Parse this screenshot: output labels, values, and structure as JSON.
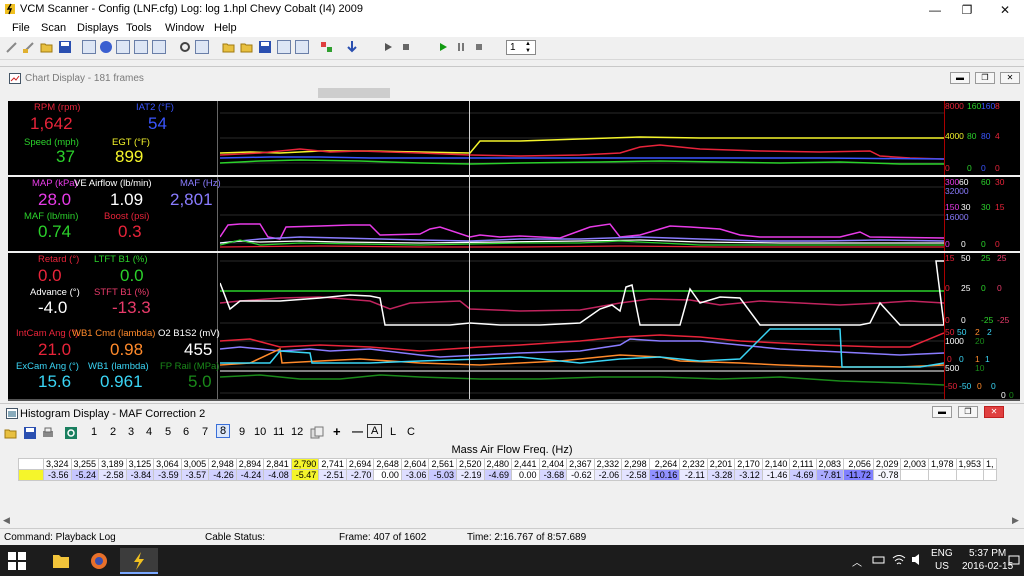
{
  "window": {
    "title": "VCM Scanner - Config (LNF.cfg)   Log: log 1.hpl   Chevy Cobalt (I4) 2009",
    "controls": {
      "minimize": "—",
      "maximize": "❐",
      "close": "✕"
    }
  },
  "menu": [
    "File",
    "Scan",
    "Displays",
    "Tools",
    "Window",
    "Help"
  ],
  "toolbar": {
    "spin_value": "1"
  },
  "chart_window": {
    "title": "Chart Display  -  181 frames",
    "panels": [
      {
        "params": [
          {
            "label": "RPM (rpm)",
            "value": "1,642",
            "color": "#e8243a"
          },
          {
            "label": "IAT2 (°F)",
            "value": "54",
            "color": "#3a55ff"
          },
          {
            "label": "Speed (mph)",
            "value": "37",
            "color": "#2bd12b"
          },
          {
            "label": "EGT (°F)",
            "value": "899",
            "color": "#f5f52b"
          }
        ],
        "scales": [
          {
            "text": "8000",
            "color": "#e8243a"
          },
          {
            "text": "160",
            "color": "#2bd12b"
          },
          {
            "text": "160",
            "color": "#3a55ff"
          },
          {
            "text": "8",
            "color": "#e8243a"
          },
          {
            "text": "4000",
            "color": "#f5f52b"
          },
          {
            "text": "80",
            "color": "#2bd12b"
          },
          {
            "text": "80",
            "color": "#3a55ff"
          },
          {
            "text": "4",
            "color": "#e8243a"
          },
          {
            "text": "0",
            "color": "#e8243a"
          },
          {
            "text": "0",
            "color": "#2bd12b"
          },
          {
            "text": "0",
            "color": "#3a55ff"
          },
          {
            "text": "0",
            "color": "#e8243a"
          }
        ]
      },
      {
        "params": [
          {
            "label": "MAP (kPa)",
            "value": "28.0",
            "color": "#e83be8"
          },
          {
            "label": "VE Airflow (lb/min)",
            "value": "1.09",
            "color": "#ffffff"
          },
          {
            "label": "MAF (Hz)",
            "value": "2,801",
            "color": "#8a7cff"
          },
          {
            "label": "MAF (lb/min)",
            "value": "0.74",
            "color": "#2bd12b"
          },
          {
            "label": "Boost (psi)",
            "value": "0.3",
            "color": "#e8243a"
          }
        ],
        "scales": [
          {
            "text": "300",
            "color": "#e83be8"
          },
          {
            "text": "60",
            "color": "#ffffff"
          },
          {
            "text": "60",
            "color": "#2bd12b"
          },
          {
            "text": "30",
            "color": "#e8243a"
          },
          {
            "text": "32000",
            "color": "#8a7cff"
          },
          {
            "text": "150",
            "color": "#e83be8"
          },
          {
            "text": "30",
            "color": "#ffffff"
          },
          {
            "text": "30",
            "color": "#2bd12b"
          },
          {
            "text": "15",
            "color": "#e8243a"
          },
          {
            "text": "16000",
            "color": "#8a7cff"
          },
          {
            "text": "0",
            "color": "#e83be8"
          },
          {
            "text": "0",
            "color": "#ffffff"
          },
          {
            "text": "0",
            "color": "#2bd12b"
          },
          {
            "text": "0",
            "color": "#e8243a"
          }
        ]
      },
      {
        "params": [
          {
            "label": "Retard (°)",
            "value": "0.0",
            "color": "#e8243a"
          },
          {
            "label": "LTFT B1 (%)",
            "value": "0.0",
            "color": "#2bd12b"
          },
          {
            "label": "Advance (°)",
            "value": "-4.0",
            "color": "#ffffff"
          },
          {
            "label": "STFT B1 (%)",
            "value": "-13.3",
            "color": "#e83b6a"
          }
        ],
        "scales": [
          {
            "text": "15",
            "color": "#e8243a"
          },
          {
            "text": "50",
            "color": "#ffffff"
          },
          {
            "text": "25",
            "color": "#2bd12b"
          },
          {
            "text": "25",
            "color": "#e83b6a"
          },
          {
            "text": "0",
            "color": "#e8243a"
          },
          {
            "text": "25",
            "color": "#ffffff"
          },
          {
            "text": "0",
            "color": "#2bd12b"
          },
          {
            "text": "0",
            "color": "#e83b6a"
          },
          {
            "text": "0",
            "color": "#e8243a"
          },
          {
            "text": "0",
            "color": "#ffffff"
          },
          {
            "text": "-25",
            "color": "#2bd12b"
          },
          {
            "text": "-25",
            "color": "#e83b6a"
          }
        ]
      },
      {
        "params": [
          {
            "label": "IntCam Ang (°)",
            "value": "21.0",
            "color": "#e8243a"
          },
          {
            "label": "WB1 Cmd (lambda)",
            "value": "0.98",
            "color": "#ff8a2b"
          },
          {
            "label": "O2 B1S2 (mV)",
            "value": "455",
            "color": "#ffffff"
          },
          {
            "label": "ExCam Ang (°)",
            "value": "15.6",
            "color": "#3ad5f5"
          },
          {
            "label": "WB1 (lambda)",
            "value": "0.961",
            "color": "#3ad5f5"
          },
          {
            "label": "FP Rail (MPa)",
            "value": "5.0",
            "color": "#1a8a1a"
          }
        ],
        "scales": [
          {
            "text": "50",
            "color": "#e8243a"
          },
          {
            "text": "50",
            "color": "#3ad5f5"
          },
          {
            "text": "2",
            "color": "#ff8a2b"
          },
          {
            "text": "2",
            "color": "#3ad5f5"
          },
          {
            "text": "1000",
            "color": "#ffffff"
          },
          {
            "text": "20",
            "color": "#1a8a1a"
          },
          {
            "text": "0",
            "color": "#e8243a"
          },
          {
            "text": "0",
            "color": "#3ad5f5"
          },
          {
            "text": "1",
            "color": "#ff8a2b"
          },
          {
            "text": "1",
            "color": "#3ad5f5"
          },
          {
            "text": "500",
            "color": "#ffffff"
          },
          {
            "text": "10",
            "color": "#1a8a1a"
          },
          {
            "text": "-50",
            "color": "#e8243a"
          },
          {
            "text": "-50",
            "color": "#3ad5f5"
          },
          {
            "text": "0",
            "color": "#ff8a2b"
          },
          {
            "text": "0",
            "color": "#3ad5f5"
          },
          {
            "text": "0",
            "color": "#ffffff"
          },
          {
            "text": "0",
            "color": "#1a8a1a"
          }
        ]
      }
    ]
  },
  "histogram": {
    "title": "Histogram Display  -  MAF Correction 2",
    "toolbar_numbers": [
      "1",
      "2",
      "3",
      "4",
      "5",
      "6",
      "7",
      "8",
      "9",
      "10",
      "11",
      "12"
    ],
    "toolbar_ops": [
      "+",
      "—",
      "A",
      "L",
      "C"
    ],
    "table_title": "Mass Air Flow Freq. (Hz)",
    "headers": [
      "3,324",
      "3,255",
      "3,189",
      "3,125",
      "3,064",
      "3,005",
      "2,948",
      "2,894",
      "2,841",
      "2,790",
      "2,741",
      "2,694",
      "2,648",
      "2,604",
      "2,561",
      "2,520",
      "2,480",
      "2,441",
      "2,404",
      "2,367",
      "2,332",
      "2,298",
      "2,264",
      "2,232",
      "2,201",
      "2,170",
      "2,140",
      "2,111",
      "2,083",
      "2,056",
      "2,029",
      "2,003",
      "1,978",
      "1,953",
      "1,"
    ],
    "values": [
      "-3.56",
      "-5.24",
      "-2.58",
      "-3.84",
      "-3.59",
      "-3.57",
      "-4.26",
      "-4.24",
      "-4.08",
      "-5.47",
      "-2.51",
      "-2.70",
      "0.00",
      "-3.06",
      "-5.03",
      "-2.19",
      "-4.69",
      "0.00",
      "-3.68",
      "-0.62",
      "-2.06",
      "-2.58",
      "-10.16",
      "-2.11",
      "-3.28",
      "-3.12",
      "-1.46",
      "-4.69",
      "-7.81",
      "-11.72",
      "-0.78",
      "",
      "",
      "",
      ""
    ],
    "highlight_index": 9
  },
  "status": {
    "command": "Command: Playback Log",
    "cable": "Cable Status:",
    "frame": "Frame: 407 of 1602",
    "time": "Time: 2:16.767 of 8:57.689"
  },
  "taskbar": {
    "lang1": "ENG",
    "lang2": "US",
    "clock_time": "5:37 PM",
    "clock_date": "2016-02-15"
  }
}
